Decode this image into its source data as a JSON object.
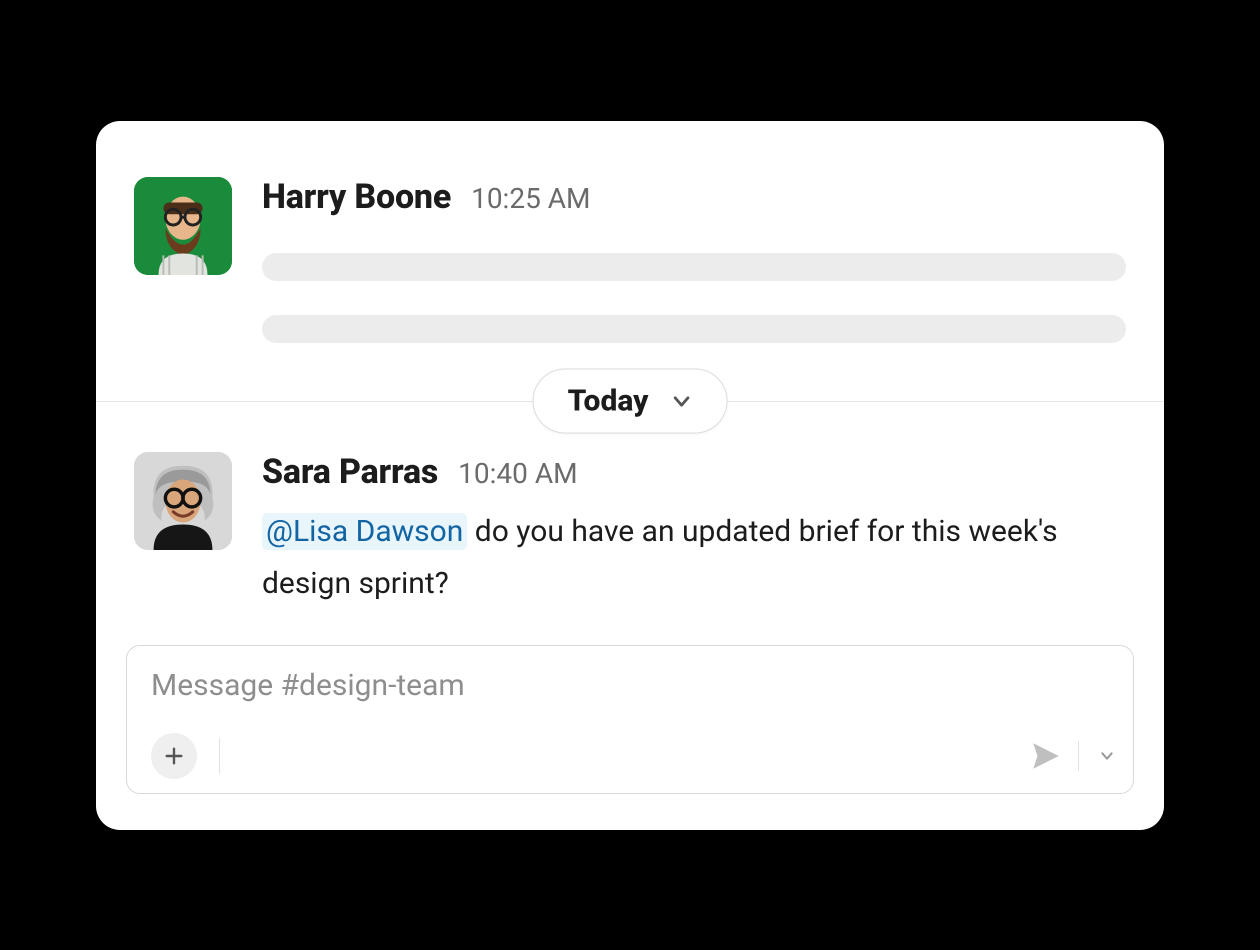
{
  "messages": [
    {
      "sender": "Harry Boone",
      "time": "10:25 AM",
      "skeleton": true
    },
    {
      "sender": "Sara Parras",
      "time": "10:40 AM",
      "mention": "@Lisa Dawson",
      "text_after_mention": " do you have an updated brief for this week's design sprint?"
    }
  ],
  "date_divider": {
    "label": "Today"
  },
  "composer": {
    "placeholder": "Message #design-team"
  }
}
